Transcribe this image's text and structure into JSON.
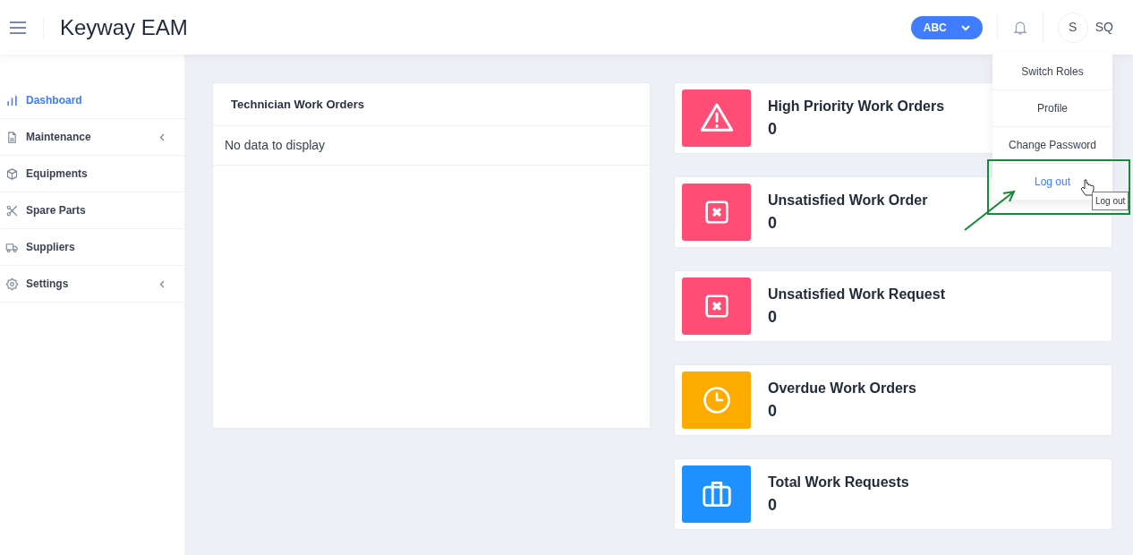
{
  "header": {
    "title": "Keyway EAM",
    "org_button": "ABC",
    "avatar": "S",
    "user": "SQ"
  },
  "sidebar": {
    "items": [
      {
        "kind": "chart",
        "label": "Dashboard",
        "selected": true,
        "submenu": false
      },
      {
        "kind": "document",
        "label": "Maintenance",
        "selected": false,
        "submenu": true
      },
      {
        "kind": "box",
        "label": "Equipments",
        "selected": false,
        "submenu": false
      },
      {
        "kind": "tools",
        "label": "Spare Parts",
        "selected": false,
        "submenu": false
      },
      {
        "kind": "truck",
        "label": "Suppliers",
        "selected": false,
        "submenu": false
      },
      {
        "kind": "gear",
        "label": "Settings",
        "selected": false,
        "submenu": true
      }
    ]
  },
  "technician_panel": {
    "title": "Technician Work Orders",
    "empty_text": "No data to display"
  },
  "stats": [
    {
      "kind": "warning",
      "color": "#ff4d76",
      "title": "High Priority Work Orders",
      "value": "0"
    },
    {
      "kind": "cancel",
      "color": "#ff4d76",
      "title": "Unsatisfied Work Order",
      "value": "0"
    },
    {
      "kind": "cancel",
      "color": "#ff4d76",
      "title": "Unsatisfied Work Request",
      "value": "0"
    },
    {
      "kind": "clock",
      "color": "#fdab00",
      "title": "Overdue Work Orders",
      "value": "0"
    },
    {
      "kind": "briefcase",
      "color": "#1e90ff",
      "title": "Total Work Requests",
      "value": "0"
    }
  ],
  "user_menu": {
    "items": [
      {
        "label": "Switch Roles",
        "selected": false
      },
      {
        "label": "Profile",
        "selected": false
      },
      {
        "label": "Change Password",
        "selected": false
      },
      {
        "label": "Log out",
        "selected": true
      }
    ],
    "tooltip": "Log out"
  }
}
